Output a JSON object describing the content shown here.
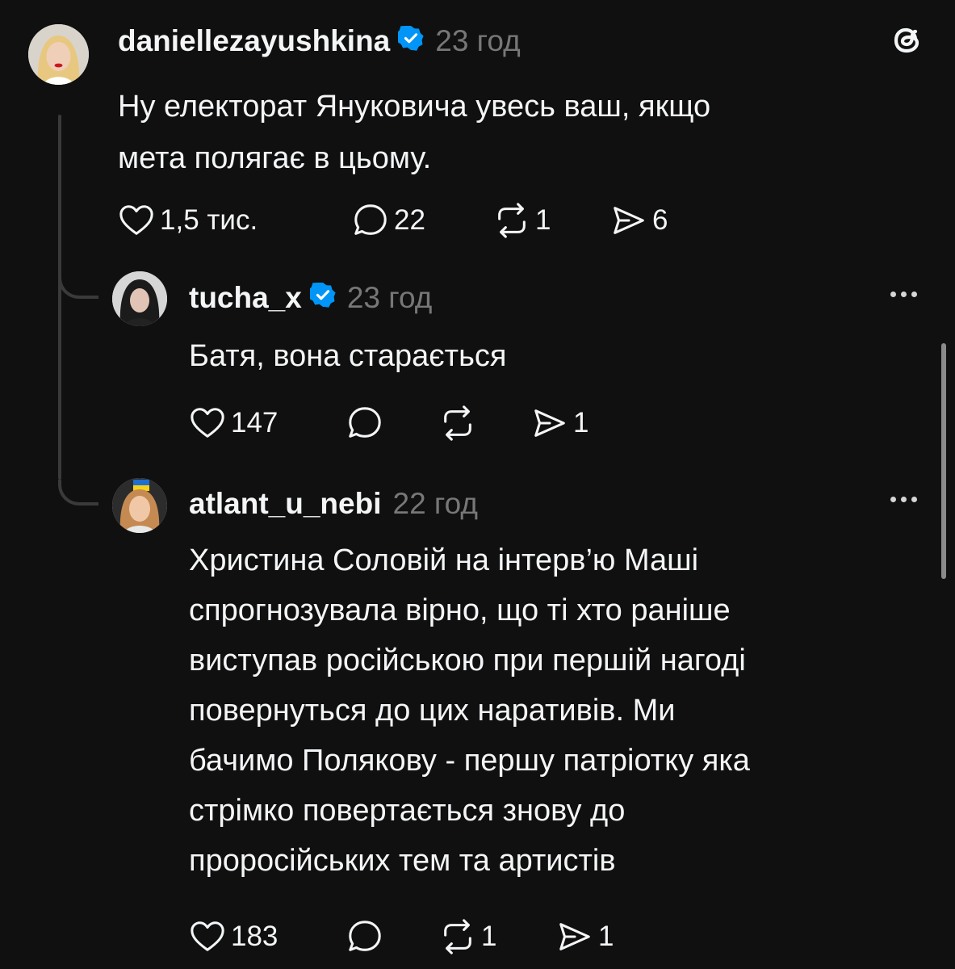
{
  "posts": [
    {
      "username": "daniellezayushkina",
      "time": "23 год",
      "text": "Ну електорат Януковича увесь ваш, якщо\nмета полягає в цьому.",
      "likes": "1,5 тис.",
      "replies": "22",
      "reposts": "1",
      "shares": "6"
    },
    {
      "username": "tucha_x",
      "time": "23 год",
      "text": "Батя, вона старається",
      "likes": "147",
      "replies": "",
      "reposts": "",
      "shares": "1"
    },
    {
      "username": "atlant_u_nebi",
      "time": "22 год",
      "text": "Христина Соловій на інтерв’ю Маші\nспрогнозувала вірно, що ті хто раніше\nвиступав російською при першій нагоді\nповернуться до цих наративів. Ми\nбачимо Полякову - першу патріотку яка\nстрімко повертається знову  до\nпроросійських тем та артистів",
      "likes": "183",
      "replies": "",
      "reposts": "1",
      "shares": "1"
    }
  ],
  "icons": {
    "app_logo": "threads-logo-icon",
    "verified": "verified-badge-icon",
    "like": "heart-icon",
    "reply": "comment-icon",
    "repost": "repost-icon",
    "share": "share-icon",
    "more": "more-options-icon"
  },
  "colors": {
    "background": "#101010",
    "text": "#f3f5f7",
    "muted": "#777777",
    "verified": "#0095f6"
  }
}
